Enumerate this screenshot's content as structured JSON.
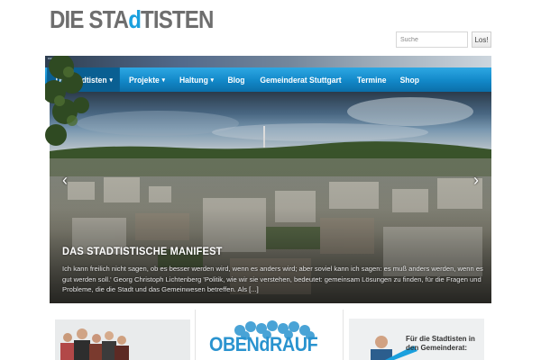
{
  "logo": {
    "part1": "DIE STA",
    "part2": "d",
    "part3": "TISTEN"
  },
  "tagline": "DIE STADTISTEN",
  "search": {
    "placeholder": "Suche",
    "button_label": "Los!"
  },
  "nav": [
    {
      "label": "Die Stadtisten",
      "caret": "▾"
    },
    {
      "label": "Projekte",
      "caret": "▾"
    },
    {
      "label": "Haltung",
      "caret": "▾"
    },
    {
      "label": "Blog",
      "caret": ""
    },
    {
      "label": "Gemeinderat Stuttgart",
      "caret": ""
    },
    {
      "label": "Termine",
      "caret": ""
    },
    {
      "label": "Shop",
      "caret": ""
    }
  ],
  "slider": {
    "prev_icon": "‹",
    "next_icon": "›",
    "caption_title": "DAS STADTISTISCHE MANIFEST",
    "caption_text": "Ich kann freilich nicht sagen, ob es besser werden wird, wenn es anders wird; aber soviel kann ich sagen: es muß anders werden, wenn es gut werden soll.' Georg Christoph Lichtenberg 'Politik, wie wir sie verstehen, bedeutet: gemeinsam Lösungen zu finden, für die Fragen und Probleme, die die Stadt und das Gemeinwesen betreffen. Als",
    "caption_more": "[...]"
  },
  "cards": {
    "card2_text": "OBENdRAUF",
    "card3_title": "Für die Stadtisten in den Gemeinderat:"
  },
  "colors": {
    "accent": "#1aa0de",
    "nav_bg": "#1288c8",
    "nav_active": "#0a5f92",
    "logo_gray": "#6e6e6e"
  }
}
